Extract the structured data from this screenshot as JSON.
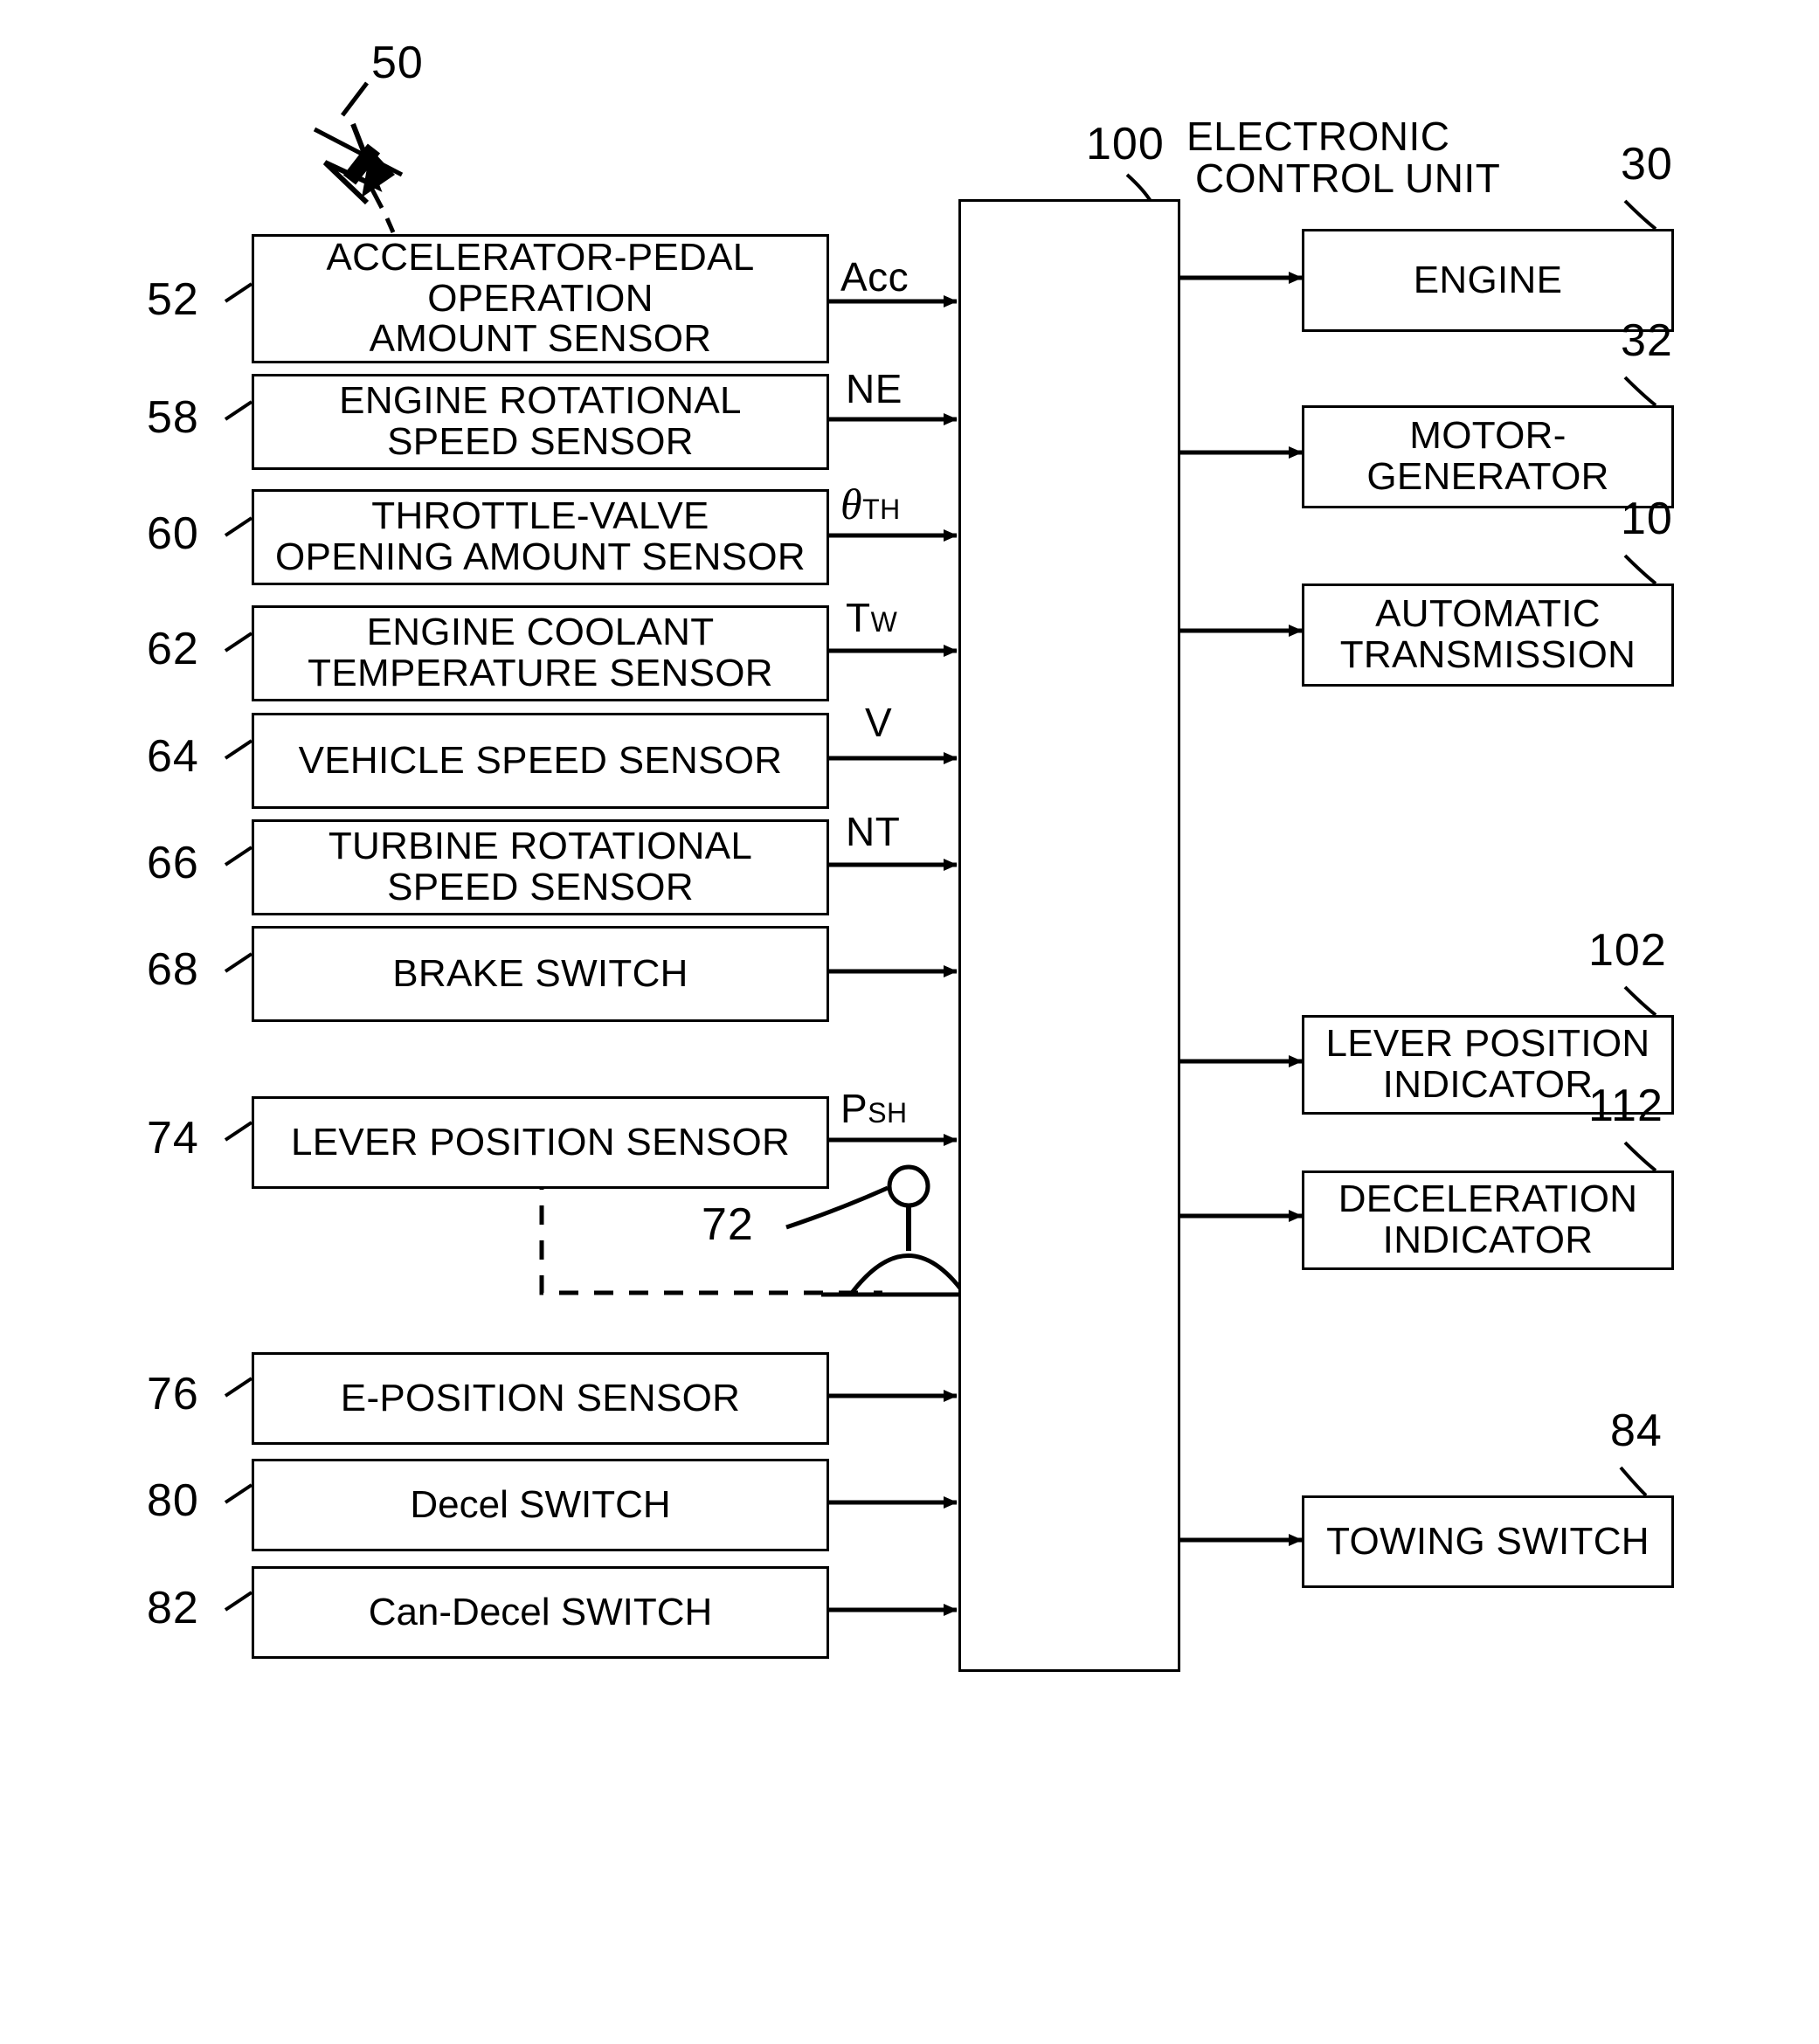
{
  "diagram": {
    "title_ref": "100",
    "ecu_label_line1": "ELECTRONIC",
    "ecu_label_line2": "CONTROL UNIT",
    "antenna_ref": "50",
    "shift_lever_ref": "72"
  },
  "inputs": [
    {
      "ref": "52",
      "lines": [
        "ACCELERATOR-PEDAL",
        "OPERATION",
        "AMOUNT SENSOR"
      ],
      "signal": "Acc",
      "signal_sub": ""
    },
    {
      "ref": "58",
      "lines": [
        "ENGINE ROTATIONAL",
        "SPEED SENSOR"
      ],
      "signal": "NE",
      "signal_sub": ""
    },
    {
      "ref": "60",
      "lines": [
        "THROTTLE-VALVE",
        "OPENING AMOUNT SENSOR"
      ],
      "signal": "θ",
      "signal_sub": "TH"
    },
    {
      "ref": "62",
      "lines": [
        "ENGINE COOLANT",
        "TEMPERATURE SENSOR"
      ],
      "signal": "T",
      "signal_sub": "W"
    },
    {
      "ref": "64",
      "lines": [
        "VEHICLE SPEED SENSOR"
      ],
      "signal": "V",
      "signal_sub": ""
    },
    {
      "ref": "66",
      "lines": [
        "TURBINE ROTATIONAL",
        "SPEED SENSOR"
      ],
      "signal": "NT",
      "signal_sub": ""
    },
    {
      "ref": "68",
      "lines": [
        "BRAKE SWITCH"
      ],
      "signal": "",
      "signal_sub": ""
    },
    {
      "ref": "74",
      "lines": [
        "LEVER POSITION SENSOR"
      ],
      "signal": "P",
      "signal_sub": "SH"
    },
    {
      "ref": "76",
      "lines": [
        "E-POSITION SENSOR"
      ],
      "signal": "",
      "signal_sub": ""
    },
    {
      "ref": "80",
      "lines": [
        "Decel SWITCH"
      ],
      "signal": "",
      "signal_sub": ""
    },
    {
      "ref": "82",
      "lines": [
        "Can-Decel SWITCH"
      ],
      "signal": "",
      "signal_sub": ""
    }
  ],
  "outputs": [
    {
      "ref": "30",
      "lines": [
        "ENGINE"
      ]
    },
    {
      "ref": "32",
      "lines": [
        "MOTOR-",
        "GENERATOR"
      ]
    },
    {
      "ref": "10",
      "lines": [
        "AUTOMATIC",
        "TRANSMISSION"
      ]
    },
    {
      "ref": "102",
      "lines": [
        "LEVER POSITION",
        "INDICATOR"
      ]
    },
    {
      "ref": "112",
      "lines": [
        "DECELERATION",
        "INDICATOR"
      ]
    },
    {
      "ref": "84",
      "lines": [
        "TOWING SWITCH"
      ]
    }
  ]
}
